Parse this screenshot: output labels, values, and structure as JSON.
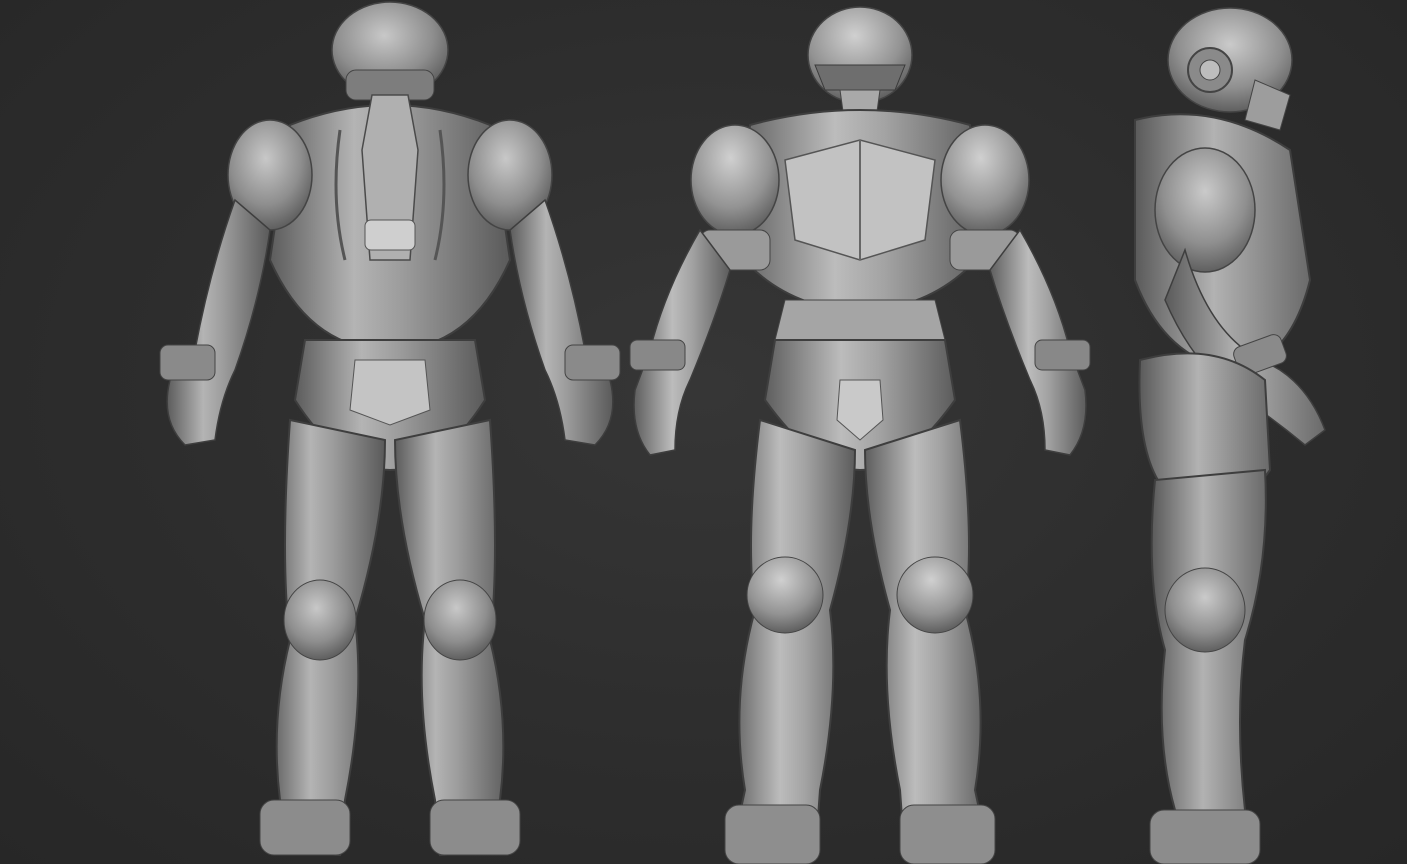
{
  "scene": {
    "background_color": "#2c2c2c",
    "material_color": "#9a9a9a",
    "views": [
      {
        "id": "back",
        "description_icon": "armored-figure-back-view"
      },
      {
        "id": "front",
        "description_icon": "armored-figure-front-view"
      },
      {
        "id": "side",
        "description_icon": "armored-figure-side-view"
      }
    ]
  }
}
